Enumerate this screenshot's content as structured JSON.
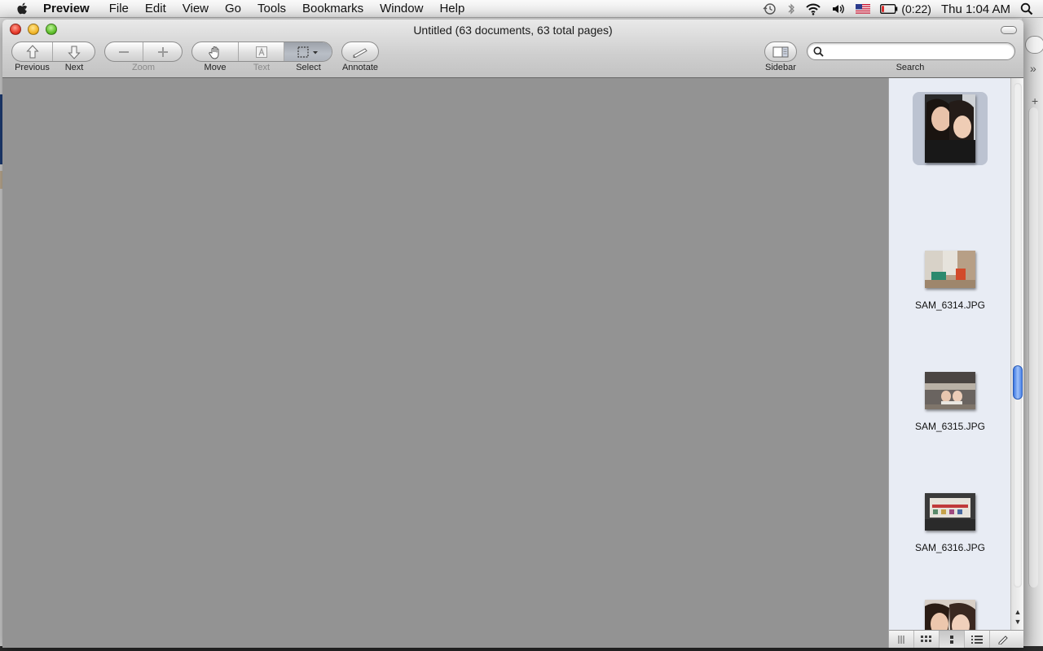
{
  "menubar": {
    "app_name": "Preview",
    "items": [
      "File",
      "Edit",
      "View",
      "Go",
      "Tools",
      "Bookmarks",
      "Window",
      "Help"
    ],
    "battery_text": "(0:22)",
    "clock": "Thu 1:04 AM"
  },
  "window": {
    "title": "Untitled (63 documents, 63 total pages)"
  },
  "toolbar": {
    "previous_label": "Previous",
    "next_label": "Next",
    "zoom_label": "Zoom",
    "move_label": "Move",
    "text_label": "Text",
    "select_label": "Select",
    "annotate_label": "Annotate",
    "sidebar_label": "Sidebar",
    "search_label": "Search",
    "search_value": ""
  },
  "sidebar": {
    "thumbnails": [
      {
        "caption": "",
        "selected": true
      },
      {
        "caption": "SAM_6314.JPG",
        "selected": false
      },
      {
        "caption": "SAM_6315.JPG",
        "selected": false
      },
      {
        "caption": "SAM_6316.JPG",
        "selected": false
      },
      {
        "caption": "",
        "selected": false
      }
    ],
    "scroll_position": 0.6
  },
  "colors": {
    "content_bg": "#939393",
    "sidebar_bg": "#e8ecf4",
    "selection": "#bcc3d1",
    "scroll_knob": "#3c78e3"
  }
}
